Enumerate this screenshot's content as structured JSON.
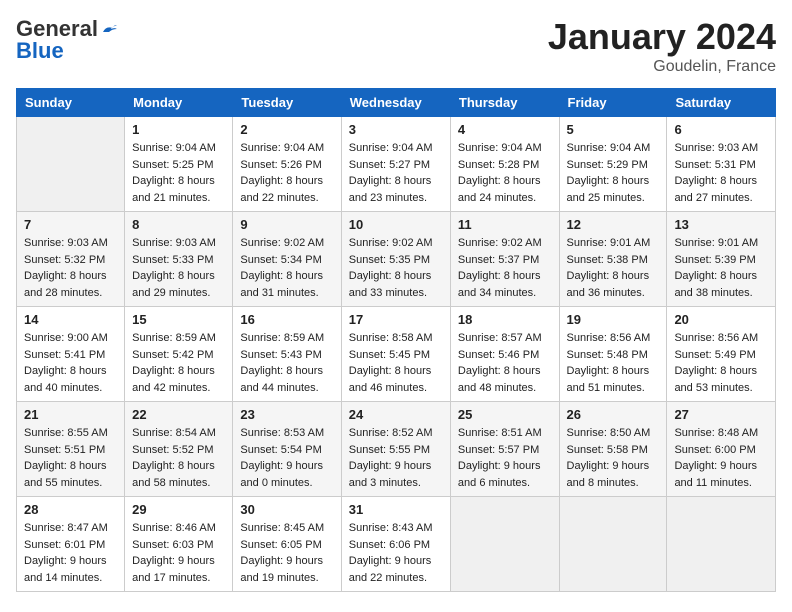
{
  "header": {
    "logo_general": "General",
    "logo_blue": "Blue",
    "month_title": "January 2024",
    "location": "Goudelin, France"
  },
  "days_of_week": [
    "Sunday",
    "Monday",
    "Tuesday",
    "Wednesday",
    "Thursday",
    "Friday",
    "Saturday"
  ],
  "weeks": [
    [
      {
        "day": "",
        "sunrise": "",
        "sunset": "",
        "daylight": "",
        "empty": true
      },
      {
        "day": "1",
        "sunrise": "Sunrise: 9:04 AM",
        "sunset": "Sunset: 5:25 PM",
        "daylight": "Daylight: 8 hours and 21 minutes."
      },
      {
        "day": "2",
        "sunrise": "Sunrise: 9:04 AM",
        "sunset": "Sunset: 5:26 PM",
        "daylight": "Daylight: 8 hours and 22 minutes."
      },
      {
        "day": "3",
        "sunrise": "Sunrise: 9:04 AM",
        "sunset": "Sunset: 5:27 PM",
        "daylight": "Daylight: 8 hours and 23 minutes."
      },
      {
        "day": "4",
        "sunrise": "Sunrise: 9:04 AM",
        "sunset": "Sunset: 5:28 PM",
        "daylight": "Daylight: 8 hours and 24 minutes."
      },
      {
        "day": "5",
        "sunrise": "Sunrise: 9:04 AM",
        "sunset": "Sunset: 5:29 PM",
        "daylight": "Daylight: 8 hours and 25 minutes."
      },
      {
        "day": "6",
        "sunrise": "Sunrise: 9:03 AM",
        "sunset": "Sunset: 5:31 PM",
        "daylight": "Daylight: 8 hours and 27 minutes."
      }
    ],
    [
      {
        "day": "7",
        "sunrise": "Sunrise: 9:03 AM",
        "sunset": "Sunset: 5:32 PM",
        "daylight": "Daylight: 8 hours and 28 minutes."
      },
      {
        "day": "8",
        "sunrise": "Sunrise: 9:03 AM",
        "sunset": "Sunset: 5:33 PM",
        "daylight": "Daylight: 8 hours and 29 minutes."
      },
      {
        "day": "9",
        "sunrise": "Sunrise: 9:02 AM",
        "sunset": "Sunset: 5:34 PM",
        "daylight": "Daylight: 8 hours and 31 minutes."
      },
      {
        "day": "10",
        "sunrise": "Sunrise: 9:02 AM",
        "sunset": "Sunset: 5:35 PM",
        "daylight": "Daylight: 8 hours and 33 minutes."
      },
      {
        "day": "11",
        "sunrise": "Sunrise: 9:02 AM",
        "sunset": "Sunset: 5:37 PM",
        "daylight": "Daylight: 8 hours and 34 minutes."
      },
      {
        "day": "12",
        "sunrise": "Sunrise: 9:01 AM",
        "sunset": "Sunset: 5:38 PM",
        "daylight": "Daylight: 8 hours and 36 minutes."
      },
      {
        "day": "13",
        "sunrise": "Sunrise: 9:01 AM",
        "sunset": "Sunset: 5:39 PM",
        "daylight": "Daylight: 8 hours and 38 minutes."
      }
    ],
    [
      {
        "day": "14",
        "sunrise": "Sunrise: 9:00 AM",
        "sunset": "Sunset: 5:41 PM",
        "daylight": "Daylight: 8 hours and 40 minutes."
      },
      {
        "day": "15",
        "sunrise": "Sunrise: 8:59 AM",
        "sunset": "Sunset: 5:42 PM",
        "daylight": "Daylight: 8 hours and 42 minutes."
      },
      {
        "day": "16",
        "sunrise": "Sunrise: 8:59 AM",
        "sunset": "Sunset: 5:43 PM",
        "daylight": "Daylight: 8 hours and 44 minutes."
      },
      {
        "day": "17",
        "sunrise": "Sunrise: 8:58 AM",
        "sunset": "Sunset: 5:45 PM",
        "daylight": "Daylight: 8 hours and 46 minutes."
      },
      {
        "day": "18",
        "sunrise": "Sunrise: 8:57 AM",
        "sunset": "Sunset: 5:46 PM",
        "daylight": "Daylight: 8 hours and 48 minutes."
      },
      {
        "day": "19",
        "sunrise": "Sunrise: 8:56 AM",
        "sunset": "Sunset: 5:48 PM",
        "daylight": "Daylight: 8 hours and 51 minutes."
      },
      {
        "day": "20",
        "sunrise": "Sunrise: 8:56 AM",
        "sunset": "Sunset: 5:49 PM",
        "daylight": "Daylight: 8 hours and 53 minutes."
      }
    ],
    [
      {
        "day": "21",
        "sunrise": "Sunrise: 8:55 AM",
        "sunset": "Sunset: 5:51 PM",
        "daylight": "Daylight: 8 hours and 55 minutes."
      },
      {
        "day": "22",
        "sunrise": "Sunrise: 8:54 AM",
        "sunset": "Sunset: 5:52 PM",
        "daylight": "Daylight: 8 hours and 58 minutes."
      },
      {
        "day": "23",
        "sunrise": "Sunrise: 8:53 AM",
        "sunset": "Sunset: 5:54 PM",
        "daylight": "Daylight: 9 hours and 0 minutes."
      },
      {
        "day": "24",
        "sunrise": "Sunrise: 8:52 AM",
        "sunset": "Sunset: 5:55 PM",
        "daylight": "Daylight: 9 hours and 3 minutes."
      },
      {
        "day": "25",
        "sunrise": "Sunrise: 8:51 AM",
        "sunset": "Sunset: 5:57 PM",
        "daylight": "Daylight: 9 hours and 6 minutes."
      },
      {
        "day": "26",
        "sunrise": "Sunrise: 8:50 AM",
        "sunset": "Sunset: 5:58 PM",
        "daylight": "Daylight: 9 hours and 8 minutes."
      },
      {
        "day": "27",
        "sunrise": "Sunrise: 8:48 AM",
        "sunset": "Sunset: 6:00 PM",
        "daylight": "Daylight: 9 hours and 11 minutes."
      }
    ],
    [
      {
        "day": "28",
        "sunrise": "Sunrise: 8:47 AM",
        "sunset": "Sunset: 6:01 PM",
        "daylight": "Daylight: 9 hours and 14 minutes."
      },
      {
        "day": "29",
        "sunrise": "Sunrise: 8:46 AM",
        "sunset": "Sunset: 6:03 PM",
        "daylight": "Daylight: 9 hours and 17 minutes."
      },
      {
        "day": "30",
        "sunrise": "Sunrise: 8:45 AM",
        "sunset": "Sunset: 6:05 PM",
        "daylight": "Daylight: 9 hours and 19 minutes."
      },
      {
        "day": "31",
        "sunrise": "Sunrise: 8:43 AM",
        "sunset": "Sunset: 6:06 PM",
        "daylight": "Daylight: 9 hours and 22 minutes."
      },
      {
        "day": "",
        "sunrise": "",
        "sunset": "",
        "daylight": "",
        "empty": true
      },
      {
        "day": "",
        "sunrise": "",
        "sunset": "",
        "daylight": "",
        "empty": true
      },
      {
        "day": "",
        "sunrise": "",
        "sunset": "",
        "daylight": "",
        "empty": true
      }
    ]
  ]
}
